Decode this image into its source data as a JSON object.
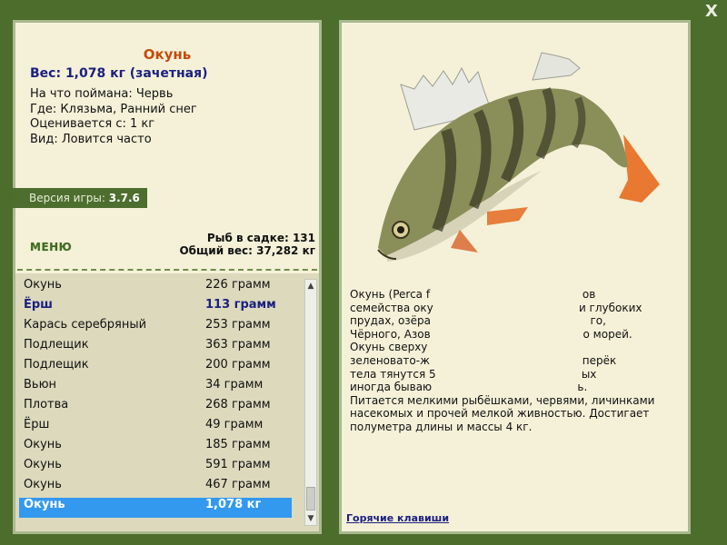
{
  "close_label": "X",
  "fish": {
    "title": "Окунь",
    "weight_line": "Вес: 1,078 кг (зачетная)",
    "caught_on": "На что поймана: Червь",
    "where": "Где: Клязьма, Ранний снег",
    "rated_from": "Оценивается с: 1 кг",
    "kind": "Вид: Ловится часто"
  },
  "version": {
    "label": "Версия игры:",
    "value": "3.7.6"
  },
  "menu_label": "МЕНЮ",
  "cage": {
    "count_line": "Рыб в садке: 131",
    "total_line": "Общий вес: 37,282 кг"
  },
  "catch_list": [
    {
      "name": "Окунь",
      "weight": "226 грамм",
      "style": "normal"
    },
    {
      "name": "Ёрш",
      "weight": "113 грамм",
      "style": "bold"
    },
    {
      "name": "Карась серебряный",
      "weight": "253 грамм",
      "style": "normal"
    },
    {
      "name": "Подлещик",
      "weight": "363 грамм",
      "style": "normal"
    },
    {
      "name": "Подлещик",
      "weight": "200 грамм",
      "style": "normal"
    },
    {
      "name": "Вьюн",
      "weight": "34 грамм",
      "style": "normal"
    },
    {
      "name": "Плотва",
      "weight": "268 грамм",
      "style": "normal"
    },
    {
      "name": "Ёрш",
      "weight": "49 грамм",
      "style": "normal"
    },
    {
      "name": "Окунь",
      "weight": "185 грамм",
      "style": "normal"
    },
    {
      "name": "Окунь",
      "weight": "591 грамм",
      "style": "normal"
    },
    {
      "name": "Окунь",
      "weight": "467 грамм",
      "style": "normal"
    },
    {
      "name": "Окунь",
      "weight": "1,078 кг",
      "style": "selected"
    }
  ],
  "description": [
    "Окунь (Perca f                                            ов",
    "семейства оку                                          и глубоких",
    "прудах, озёра                                              го,",
    "Чёрного, Азов                                            о морей.",
    "Окунь сверху",
    "зеленовато-ж                                            перёк",
    "тела тянутся 5                                          ых",
    "иногда бываю                                          ь.",
    "Питается мелкими рыбёшками, червями, личинками",
    "насекомых и прочей мелкой живностью. Достигает",
    "полуметра длины и массы 4 кг."
  ],
  "hotkeys_label": "Горячие клавиши",
  "colors": {
    "background": "#4c6d2c",
    "panel": "#f5f1d8",
    "selected": "#3399ee",
    "title": "#c44b0c",
    "accent_text": "#1c2080"
  },
  "icons": {
    "close": "close-icon",
    "scroll_up": "arrow-up-icon",
    "scroll_down": "arrow-down-icon",
    "fish": "perch-fish-image"
  }
}
